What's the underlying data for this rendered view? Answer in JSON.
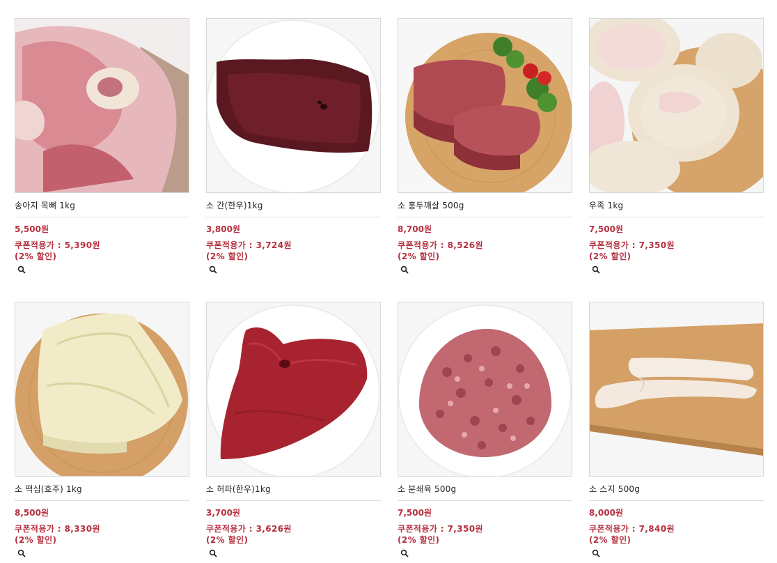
{
  "products": [
    {
      "name": "송아지 목뼈 1kg",
      "price": "5,500원",
      "coupon_label": "쿠폰적용가 : ",
      "coupon_price": "5,390원",
      "discount": "(2% 할인)"
    },
    {
      "name": "소 간(한우)1kg",
      "price": "3,800원",
      "coupon_label": "쿠폰적용가 : ",
      "coupon_price": "3,724원",
      "discount": "(2% 할인)"
    },
    {
      "name": "소 홍두깨살 500g",
      "price": "8,700원",
      "coupon_label": "쿠폰적용가 : ",
      "coupon_price": "8,526원",
      "discount": "(2% 할인)"
    },
    {
      "name": "우족 1kg",
      "price": "7,500원",
      "coupon_label": "쿠폰적용가 : ",
      "coupon_price": "7,350원",
      "discount": "(2% 할인)"
    },
    {
      "name": "소 떡심(호주) 1kg",
      "price": "8,500원",
      "coupon_label": "쿠폰적용가 : ",
      "coupon_price": "8,330원",
      "discount": "(2% 할인)"
    },
    {
      "name": "소 허파(한우)1kg",
      "price": "3,700원",
      "coupon_label": "쿠폰적용가 : ",
      "coupon_price": "3,626원",
      "discount": "(2% 할인)"
    },
    {
      "name": "소 분쇄육 500g",
      "price": "7,500원",
      "coupon_label": "쿠폰적용가 : ",
      "coupon_price": "7,350원",
      "discount": "(2% 할인)"
    },
    {
      "name": "소 스지 500g",
      "price": "8,000원",
      "coupon_label": "쿠폰적용가 : ",
      "coupon_price": "7,840원",
      "discount": "(2% 할인)"
    }
  ],
  "colors": {
    "price_red": "#b5303f",
    "border": "#d8d8d8"
  },
  "icons": {
    "zoom": "magnifier-icon"
  }
}
